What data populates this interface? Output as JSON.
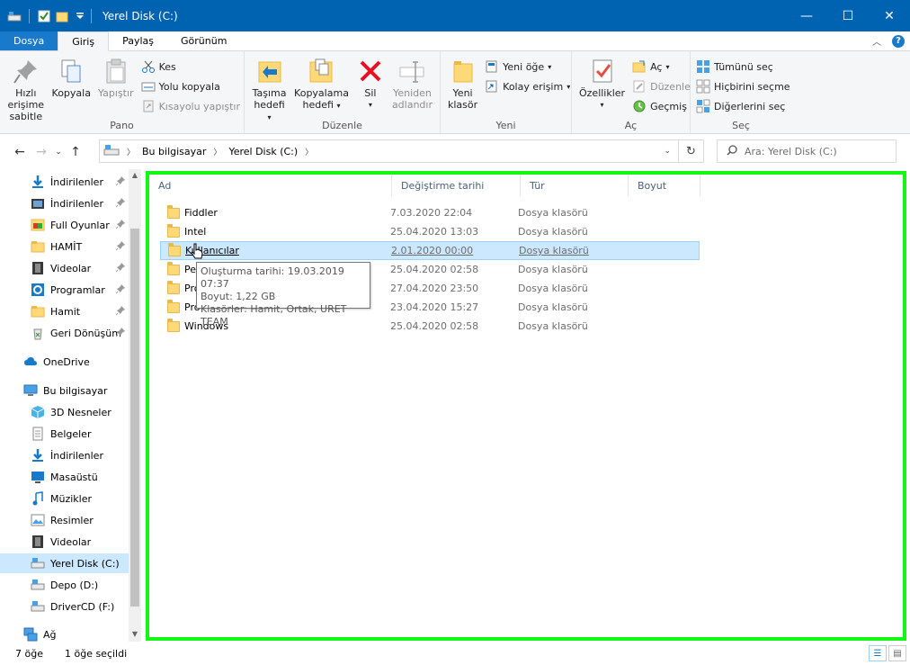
{
  "window": {
    "title": "Yerel Disk (C:)",
    "minimize": "—",
    "maximize": "☐",
    "close": "✕"
  },
  "ribbon_tabs": [
    "Dosya",
    "Giriş",
    "Paylaş",
    "Görünüm"
  ],
  "ribbon": {
    "pano": {
      "label": "Pano",
      "pin": "Hızlı erişime sabitle",
      "pin_l1": "Hızlı erişime",
      "pin_l2": "sabitle",
      "copy": "Kopyala",
      "paste": "Yapıştır",
      "cut": "Kes",
      "copy_path": "Yolu kopyala",
      "paste_shortcut": "Kısayolu yapıştır"
    },
    "duzenle": {
      "label": "Düzenle",
      "move_l1": "Taşıma",
      "move_l2": "hedefi",
      "copyto_l1": "Kopyalama",
      "copyto_l2": "hedefi",
      "delete": "Sil",
      "rename_l1": "Yeniden",
      "rename_l2": "adlandır"
    },
    "yeni": {
      "label": "Yeni",
      "newfolder_l1": "Yeni",
      "newfolder_l2": "klasör",
      "newitem": "Yeni öğe",
      "easyaccess": "Kolay erişim"
    },
    "ac": {
      "label": "Aç",
      "properties": "Özellikler",
      "open": "Aç",
      "edit": "Düzenle",
      "history": "Geçmiş"
    },
    "sec": {
      "label": "Seç",
      "selectall": "Tümünü seç",
      "selectnone": "Hiçbirini seçme",
      "invert": "Diğerlerini seç"
    }
  },
  "address": {
    "crumbs": [
      "Bu bilgisayar",
      "Yerel Disk (C:)"
    ],
    "search_placeholder": "Ara: Yerel Disk (C:)"
  },
  "nav_items": [
    {
      "label": "İndirilenler",
      "icon": "download-icon",
      "pinned": true
    },
    {
      "label": "İndirilenler",
      "icon": "movie-icon",
      "pinned": true
    },
    {
      "label": "Full Oyunlar",
      "icon": "game-icon",
      "pinned": true
    },
    {
      "label": "HAMİT",
      "icon": "folder-icon",
      "pinned": true
    },
    {
      "label": "Videolar",
      "icon": "film-icon",
      "pinned": true
    },
    {
      "label": "Programlar",
      "icon": "gear-icon",
      "pinned": true
    },
    {
      "label": "Hamit",
      "icon": "folder-icon",
      "pinned": true
    },
    {
      "label": "Geri Dönüşüm",
      "icon": "recycle-icon",
      "pinned": true
    },
    {
      "label": "OneDrive",
      "icon": "cloud-icon",
      "pinned": false
    },
    {
      "label": "Bu bilgisayar",
      "icon": "computer-icon",
      "pinned": false
    },
    {
      "label": "3D Nesneler",
      "icon": "cube-icon",
      "pinned": false
    },
    {
      "label": "Belgeler",
      "icon": "document-icon",
      "pinned": false
    },
    {
      "label": "İndirilenler",
      "icon": "download-icon",
      "pinned": false
    },
    {
      "label": "Masaüstü",
      "icon": "desktop-icon",
      "pinned": false
    },
    {
      "label": "Müzikler",
      "icon": "music-icon",
      "pinned": false
    },
    {
      "label": "Resimler",
      "icon": "picture-icon",
      "pinned": false
    },
    {
      "label": "Videolar",
      "icon": "film-icon",
      "pinned": false
    },
    {
      "label": "Yerel Disk (C:)",
      "icon": "drive-icon",
      "pinned": false,
      "selected": true
    },
    {
      "label": "Depo (D:)",
      "icon": "drive-icon",
      "pinned": false
    },
    {
      "label": "DriverCD (F:)",
      "icon": "drive-icon",
      "pinned": false
    },
    {
      "label": "Ağ",
      "icon": "network-icon",
      "pinned": false
    }
  ],
  "columns": [
    "Ad",
    "Değiştirme tarihi",
    "Tür",
    "Boyut"
  ],
  "files": [
    {
      "name": "Fiddler",
      "date": "7.03.2020 22:04",
      "type": "Dosya klasörü"
    },
    {
      "name": "Intel",
      "date": "25.04.2020 13:03",
      "type": "Dosya klasörü"
    },
    {
      "name": "Kullanıcılar",
      "date": "2.01.2020 00:00",
      "type": "Dosya klasörü",
      "selected": true
    },
    {
      "name": "Pe",
      "date": "25.04.2020 02:58",
      "type": "Dosya klasörü"
    },
    {
      "name": "Pro",
      "date": "27.04.2020 23:50",
      "type": "Dosya klasörü"
    },
    {
      "name": "Pro",
      "date": "23.04.2020 15:27",
      "type": "Dosya klasörü"
    },
    {
      "name": "Windows",
      "date": "25.04.2020 02:58",
      "type": "Dosya klasörü"
    }
  ],
  "tooltip": {
    "line1": "Oluşturma tarihi: 19.03.2019 07:37",
    "line2": "Boyut: 1,22 GB",
    "line3": "Klasörler: Hamit, Ortak, URET TEAM"
  },
  "status": {
    "count": "7 öğe",
    "selected": "1 öğe seçildi"
  },
  "colors": {
    "titlebar": "#0063b1",
    "file_tab": "#1979ca",
    "selection": "#cce8ff",
    "highlight_border": "#14f614"
  }
}
